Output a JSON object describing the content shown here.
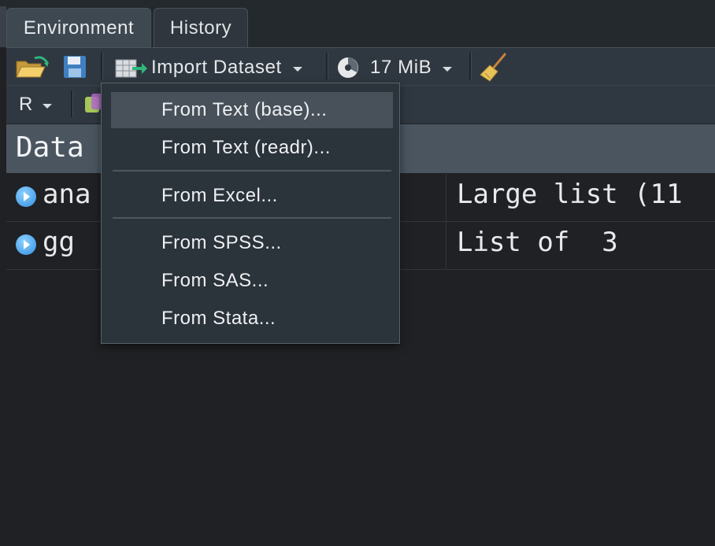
{
  "tabs": [
    {
      "label": "Environment",
      "active": true
    },
    {
      "label": "History",
      "active": false
    }
  ],
  "toolbar": {
    "import_label": "Import Dataset",
    "memory_label": "17 MiB",
    "language_label": "R"
  },
  "data_header": "Data",
  "rows": [
    {
      "name": "ana",
      "value": "Large list (11"
    },
    {
      "name": "gg",
      "value": "List of  3"
    }
  ],
  "menu": {
    "items": [
      {
        "label": "From Text (base)...",
        "highlighted": true
      },
      {
        "label": "From Text (readr)...",
        "highlighted": false
      },
      {
        "label": "From Excel...",
        "highlighted": false
      },
      {
        "label": "From SPSS...",
        "highlighted": false
      },
      {
        "label": "From SAS...",
        "highlighted": false
      },
      {
        "label": "From Stata...",
        "highlighted": false
      }
    ]
  },
  "colors": {
    "accent_blue": "#2f8fe0",
    "arrow_green": "#2fb67a",
    "panel_bg": "#202124"
  },
  "icons": [
    "open-folder-icon",
    "save-icon",
    "import-table-icon",
    "memory-pie-icon",
    "broom-icon",
    "caret-down-icon",
    "expand-arrow-icon"
  ]
}
